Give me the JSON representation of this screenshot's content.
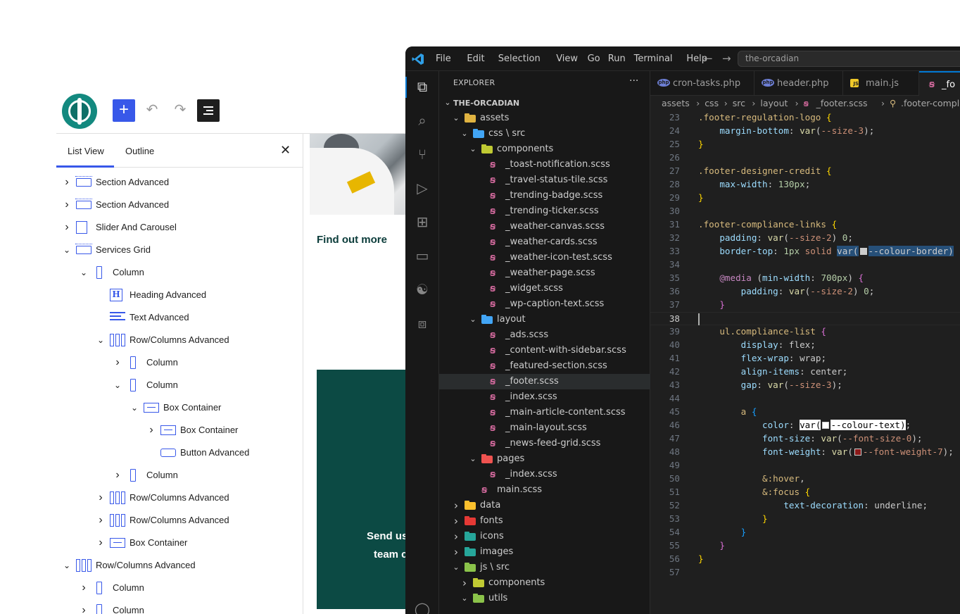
{
  "wp": {
    "tabs": {
      "list_view": "List View",
      "outline": "Outline"
    },
    "list": [
      {
        "label": "Section Advanced",
        "icon": "section",
        "chevron": "›",
        "depth": 0
      },
      {
        "label": "Section Advanced",
        "icon": "section",
        "chevron": "›",
        "depth": 0
      },
      {
        "label": "Slider And Carousel",
        "icon": "slider",
        "chevron": "›",
        "depth": 0
      },
      {
        "label": "Services Grid",
        "icon": "section",
        "chevron": "⌄",
        "depth": 0
      },
      {
        "label": "Column",
        "icon": "column",
        "chevron": "⌄",
        "depth": 1
      },
      {
        "label": "Heading Advanced",
        "icon": "heading",
        "chevron": "",
        "depth": 2
      },
      {
        "label": "Text Advanced",
        "icon": "text",
        "chevron": "",
        "depth": 2
      },
      {
        "label": "Row/Columns Advanced",
        "icon": "rowcols",
        "chevron": "⌄",
        "depth": 2
      },
      {
        "label": "Column",
        "icon": "column",
        "chevron": "›",
        "depth": 3
      },
      {
        "label": "Column",
        "icon": "column",
        "chevron": "⌄",
        "depth": 3
      },
      {
        "label": "Box Container",
        "icon": "box",
        "chevron": "⌄",
        "depth": 4
      },
      {
        "label": "Box Container",
        "icon": "box",
        "chevron": "›",
        "depth": 5
      },
      {
        "label": "Button Advanced",
        "icon": "button",
        "chevron": "",
        "depth": 5
      },
      {
        "label": "Column",
        "icon": "column",
        "chevron": "›",
        "depth": 3
      },
      {
        "label": "Row/Columns Advanced",
        "icon": "rowcols",
        "chevron": "›",
        "depth": 2
      },
      {
        "label": "Row/Columns Advanced",
        "icon": "rowcols",
        "chevron": "›",
        "depth": 2
      },
      {
        "label": "Box Container",
        "icon": "box",
        "chevron": "›",
        "depth": 2
      },
      {
        "label": "Row/Columns Advanced",
        "icon": "rowcols",
        "chevron": "⌄",
        "depth": 0
      },
      {
        "label": "Column",
        "icon": "column",
        "chevron": "›",
        "depth": 1
      },
      {
        "label": "Column",
        "icon": "column",
        "chevron": "›",
        "depth": 1
      }
    ],
    "canvas": {
      "find_out": "Find out more",
      "cta_line1": "Send us",
      "cta_line2": "team c"
    }
  },
  "vscode": {
    "menu": [
      "File",
      "Edit",
      "Selection",
      "View",
      "Go",
      "Run",
      "Terminal",
      "Help"
    ],
    "command_center": "the-orcadian",
    "explorer_title": "EXPLORER",
    "tabs": [
      {
        "label": "cron-tasks.php",
        "type": "php"
      },
      {
        "label": "header.php",
        "type": "php"
      },
      {
        "label": "main.js",
        "type": "js"
      },
      {
        "label": "_fo",
        "type": "scss"
      }
    ],
    "breadcrumb": [
      "assets",
      "css",
      "src",
      "layout",
      "_footer.scss",
      ".footer-compliance-link"
    ],
    "tree": [
      {
        "label": "THE-ORCADIAN",
        "kind": "root",
        "depth": 0,
        "open": true
      },
      {
        "label": "assets",
        "kind": "folder",
        "color": "#e0b341",
        "depth": 1,
        "open": true
      },
      {
        "label": "css \\ src",
        "kind": "folder",
        "color": "#42a5f5",
        "depth": 2,
        "open": true
      },
      {
        "label": "components",
        "kind": "folder",
        "color": "#c0ca33",
        "depth": 3,
        "open": true
      },
      {
        "label": "_toast-notification.scss",
        "kind": "file",
        "depth": 4
      },
      {
        "label": "_travel-status-tile.scss",
        "kind": "file",
        "depth": 4
      },
      {
        "label": "_trending-badge.scss",
        "kind": "file",
        "depth": 4
      },
      {
        "label": "_trending-ticker.scss",
        "kind": "file",
        "depth": 4
      },
      {
        "label": "_weather-canvas.scss",
        "kind": "file",
        "depth": 4
      },
      {
        "label": "_weather-cards.scss",
        "kind": "file",
        "depth": 4
      },
      {
        "label": "_weather-icon-test.scss",
        "kind": "file",
        "depth": 4
      },
      {
        "label": "_weather-page.scss",
        "kind": "file",
        "depth": 4
      },
      {
        "label": "_widget.scss",
        "kind": "file",
        "depth": 4
      },
      {
        "label": "_wp-caption-text.scss",
        "kind": "file",
        "depth": 4
      },
      {
        "label": "layout",
        "kind": "folder",
        "color": "#42a5f5",
        "depth": 3,
        "open": true
      },
      {
        "label": "_ads.scss",
        "kind": "file",
        "depth": 4
      },
      {
        "label": "_content-with-sidebar.scss",
        "kind": "file",
        "depth": 4
      },
      {
        "label": "_featured-section.scss",
        "kind": "file",
        "depth": 4
      },
      {
        "label": "_footer.scss",
        "kind": "file",
        "depth": 4,
        "selected": true
      },
      {
        "label": "_index.scss",
        "kind": "file",
        "depth": 4
      },
      {
        "label": "_main-article-content.scss",
        "kind": "file",
        "depth": 4
      },
      {
        "label": "_main-layout.scss",
        "kind": "file",
        "depth": 4
      },
      {
        "label": "_news-feed-grid.scss",
        "kind": "file",
        "depth": 4
      },
      {
        "label": "pages",
        "kind": "folder",
        "color": "#ef5350",
        "depth": 3,
        "open": true
      },
      {
        "label": "_index.scss",
        "kind": "file",
        "depth": 4
      },
      {
        "label": "main.scss",
        "kind": "file",
        "depth": 3
      },
      {
        "label": "data",
        "kind": "folder",
        "color": "#fbc02d",
        "depth": 1,
        "open": false
      },
      {
        "label": "fonts",
        "kind": "folder",
        "color": "#e53935",
        "depth": 1,
        "open": false
      },
      {
        "label": "icons",
        "kind": "folder",
        "color": "#26a69a",
        "depth": 1,
        "open": false
      },
      {
        "label": "images",
        "kind": "folder",
        "color": "#26a69a",
        "depth": 1,
        "open": false
      },
      {
        "label": "js \\ src",
        "kind": "folder",
        "color": "#8bc34a",
        "depth": 1,
        "open": true
      },
      {
        "label": "components",
        "kind": "folder",
        "color": "#c0ca33",
        "depth": 2,
        "open": false
      },
      {
        "label": "utils",
        "kind": "folder",
        "color": "#8bc34a",
        "depth": 2,
        "open": true
      }
    ],
    "line_numbers": [
      "23",
      "24",
      "25",
      "26",
      "27",
      "28",
      "29",
      "30",
      "31",
      "32",
      "33",
      "34",
      "35",
      "36",
      "37",
      "38",
      "39",
      "40",
      "41",
      "42",
      "43",
      "44",
      "45",
      "46",
      "47",
      "48",
      "49",
      "50",
      "51",
      "52",
      "53",
      "54",
      "55",
      "56",
      "57"
    ],
    "current_line": "38",
    "code": [
      [
        [
          ".footer-regulation-logo ",
          "sel"
        ],
        [
          "{",
          "br1"
        ]
      ],
      [
        [
          "    ",
          ""
        ],
        [
          "margin-bottom",
          "prop"
        ],
        [
          ": ",
          ""
        ],
        [
          "var",
          "fn"
        ],
        [
          "(",
          ""
        ],
        [
          "--size-3",
          "var"
        ],
        [
          ");",
          ""
        ]
      ],
      [
        [
          "}",
          "br1"
        ]
      ],
      [],
      [
        [
          ".footer-designer-credit ",
          "sel"
        ],
        [
          "{",
          "br1"
        ]
      ],
      [
        [
          "    ",
          ""
        ],
        [
          "max-width",
          "prop"
        ],
        [
          ": ",
          ""
        ],
        [
          "130px",
          "num"
        ],
        [
          ";",
          ""
        ]
      ],
      [
        [
          "}",
          "br1"
        ]
      ],
      [],
      [
        [
          ".footer-compliance-links ",
          "sel"
        ],
        [
          "{",
          "br1"
        ]
      ],
      [
        [
          "    ",
          ""
        ],
        [
          "padding",
          "prop"
        ],
        [
          ": ",
          ""
        ],
        [
          "var",
          "fn"
        ],
        [
          "(",
          ""
        ],
        [
          "--size-2",
          "var"
        ],
        [
          ") ",
          ""
        ],
        [
          "0",
          "num"
        ],
        [
          ";",
          ""
        ]
      ],
      [
        [
          "    ",
          ""
        ],
        [
          "border-top",
          "prop"
        ],
        [
          ": ",
          ""
        ],
        [
          "1px",
          "num"
        ],
        [
          " solid ",
          "var"
        ],
        [
          "var(",
          "hlsel"
        ],
        [
          "SWATCH:#cccccc",
          "sw"
        ],
        [
          "--colour-border",
          "hlsel"
        ],
        [
          ")",
          "hlsel"
        ]
      ],
      [],
      [
        [
          "    ",
          ""
        ],
        [
          "@media",
          "at"
        ],
        [
          " (",
          ""
        ],
        [
          "min-width",
          "prop"
        ],
        [
          ": ",
          ""
        ],
        [
          "700px",
          "num"
        ],
        [
          ") ",
          ""
        ],
        [
          "{",
          "br2"
        ]
      ],
      [
        [
          "        ",
          ""
        ],
        [
          "padding",
          "prop"
        ],
        [
          ": ",
          ""
        ],
        [
          "var",
          "fn"
        ],
        [
          "(",
          ""
        ],
        [
          "--size-2",
          "var"
        ],
        [
          ") ",
          ""
        ],
        [
          "0",
          "num"
        ],
        [
          ";",
          ""
        ]
      ],
      [
        [
          "    ",
          ""
        ],
        [
          "}",
          "br2"
        ]
      ],
      [],
      [
        [
          "    ",
          ""
        ],
        [
          "ul",
          "tag"
        ],
        [
          ".compliance-list ",
          "sel"
        ],
        [
          "{",
          "br2"
        ]
      ],
      [
        [
          "        ",
          ""
        ],
        [
          "display",
          "prop"
        ],
        [
          ": ",
          ""
        ],
        [
          "flex",
          ""
        ],
        [
          ";",
          ""
        ]
      ],
      [
        [
          "        ",
          ""
        ],
        [
          "flex-wrap",
          "prop"
        ],
        [
          ": ",
          ""
        ],
        [
          "wrap",
          ""
        ],
        [
          ";",
          ""
        ]
      ],
      [
        [
          "        ",
          ""
        ],
        [
          "align-items",
          "prop"
        ],
        [
          ": ",
          ""
        ],
        [
          "center",
          ""
        ],
        [
          ";",
          ""
        ]
      ],
      [
        [
          "        ",
          ""
        ],
        [
          "gap",
          "prop"
        ],
        [
          ": ",
          ""
        ],
        [
          "var",
          "fn"
        ],
        [
          "(",
          ""
        ],
        [
          "--size-3",
          "var"
        ],
        [
          ");",
          ""
        ]
      ],
      [],
      [
        [
          "        ",
          ""
        ],
        [
          "a ",
          "tag"
        ],
        [
          "{",
          "br3"
        ]
      ],
      [
        [
          "            ",
          ""
        ],
        [
          "color",
          "prop"
        ],
        [
          ": ",
          ""
        ],
        [
          "var(",
          "hlwhite"
        ],
        [
          "SWATCH:#ffffff",
          "sw"
        ],
        [
          "--colour-text)",
          "hlwhite"
        ],
        [
          ";",
          ""
        ]
      ],
      [
        [
          "            ",
          ""
        ],
        [
          "font-size",
          "prop"
        ],
        [
          ": ",
          ""
        ],
        [
          "var",
          "fn"
        ],
        [
          "(",
          ""
        ],
        [
          "--font-size-0",
          "var"
        ],
        [
          ");",
          ""
        ]
      ],
      [
        [
          "            ",
          ""
        ],
        [
          "font-weight",
          "prop"
        ],
        [
          ": ",
          ""
        ],
        [
          "var",
          "fn"
        ],
        [
          "(",
          ""
        ],
        [
          "SWATCH:#8b1a1a",
          "sw"
        ],
        [
          "--font-weight-7",
          "var"
        ],
        [
          ");",
          ""
        ]
      ],
      [],
      [
        [
          "            ",
          ""
        ],
        [
          "&:hover",
          "amp"
        ],
        [
          ",",
          ""
        ]
      ],
      [
        [
          "            ",
          ""
        ],
        [
          "&:focus ",
          "amp"
        ],
        [
          "{",
          "br1"
        ]
      ],
      [
        [
          "                ",
          ""
        ],
        [
          "text-decoration",
          "prop"
        ],
        [
          ": ",
          ""
        ],
        [
          "underline",
          ""
        ],
        [
          ";",
          ""
        ]
      ],
      [
        [
          "            ",
          ""
        ],
        [
          "}",
          "br1"
        ]
      ],
      [
        [
          "        ",
          ""
        ],
        [
          "}",
          "br3"
        ]
      ],
      [
        [
          "    ",
          ""
        ],
        [
          "}",
          "br2"
        ]
      ],
      [
        [
          "}",
          "br1"
        ]
      ],
      []
    ]
  }
}
